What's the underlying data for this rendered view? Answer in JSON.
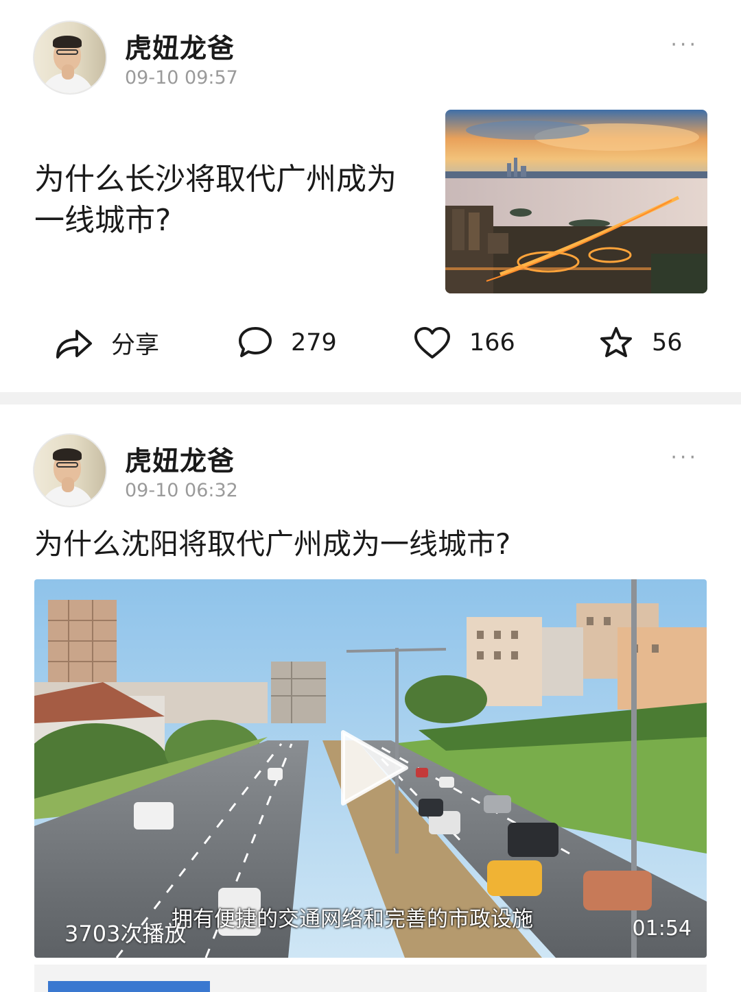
{
  "posts": [
    {
      "author": "虎妞龙爸",
      "time": "09-10 09:57",
      "more": "···",
      "title": "为什么长沙将取代广州成为一线城市?",
      "actions": {
        "share": "分享",
        "comments": "279",
        "likes": "166",
        "favorites": "56"
      }
    },
    {
      "author": "虎妞龙爸",
      "time": "09-10 06:32",
      "more": "···",
      "title": "为什么沈阳将取代广州成为一线城市?",
      "video": {
        "views": "3703次播放",
        "subtitle": "拥有便捷的交通网络和完善的市政设施",
        "duration": "01:54"
      }
    }
  ],
  "icons": {
    "share": "share-arrow-icon",
    "comment": "comment-bubble-icon",
    "like": "heart-icon",
    "favorite": "star-icon",
    "more": "more-dots-icon",
    "play": "play-icon"
  },
  "colors": {
    "text": "#1a1a1a",
    "secondary": "#9a9a9a",
    "divider": "#f1f1f1"
  }
}
